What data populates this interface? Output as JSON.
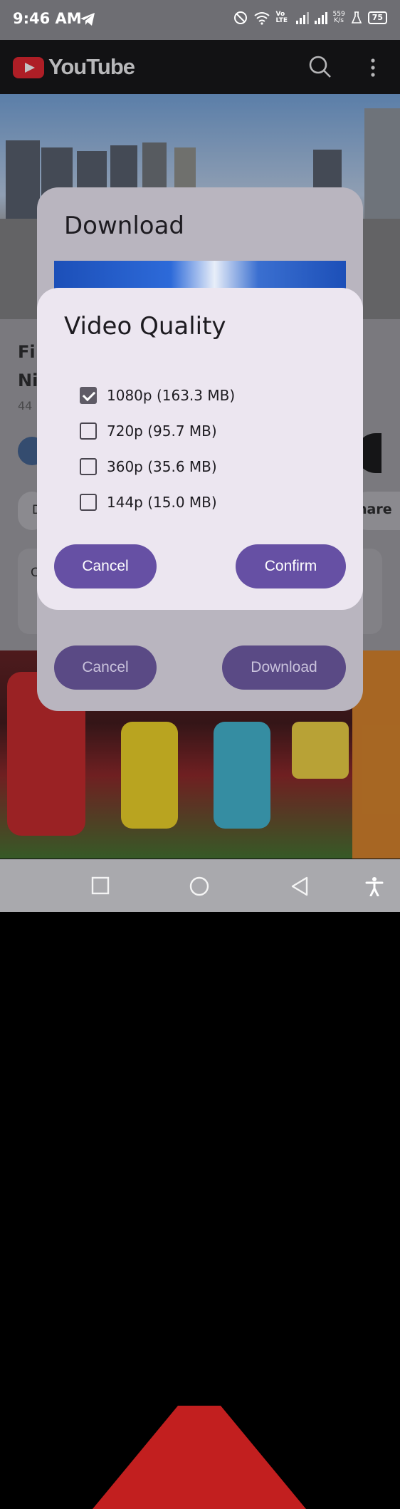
{
  "status_bar": {
    "time": "9:46 AM",
    "net_speed_value": "559",
    "net_speed_unit": "K/s",
    "volte": "Vo LTE",
    "battery": "75"
  },
  "app_bar": {
    "title": "YouTube"
  },
  "background_page": {
    "title_line1": "Fi",
    "title_line2": "Ni",
    "meta": "44",
    "share_label": "hare",
    "chip_label": "D",
    "section_letter": "C"
  },
  "download_dialog": {
    "title": "Download",
    "cancel_label": "Cancel",
    "download_label": "Download"
  },
  "quality_dialog": {
    "title": "Video Quality",
    "options": [
      {
        "label": "1080p (163.3 MB)",
        "checked": true
      },
      {
        "label": "720p (95.7 MB)",
        "checked": false
      },
      {
        "label": "360p (35.6 MB)",
        "checked": false
      },
      {
        "label": "144p (15.0 MB)",
        "checked": false
      }
    ],
    "cancel_label": "Cancel",
    "confirm_label": "Confirm"
  },
  "colors": {
    "primary": "#6650a4",
    "dialog_bg": "#ece6f0",
    "brand_red": "#e21b23"
  }
}
